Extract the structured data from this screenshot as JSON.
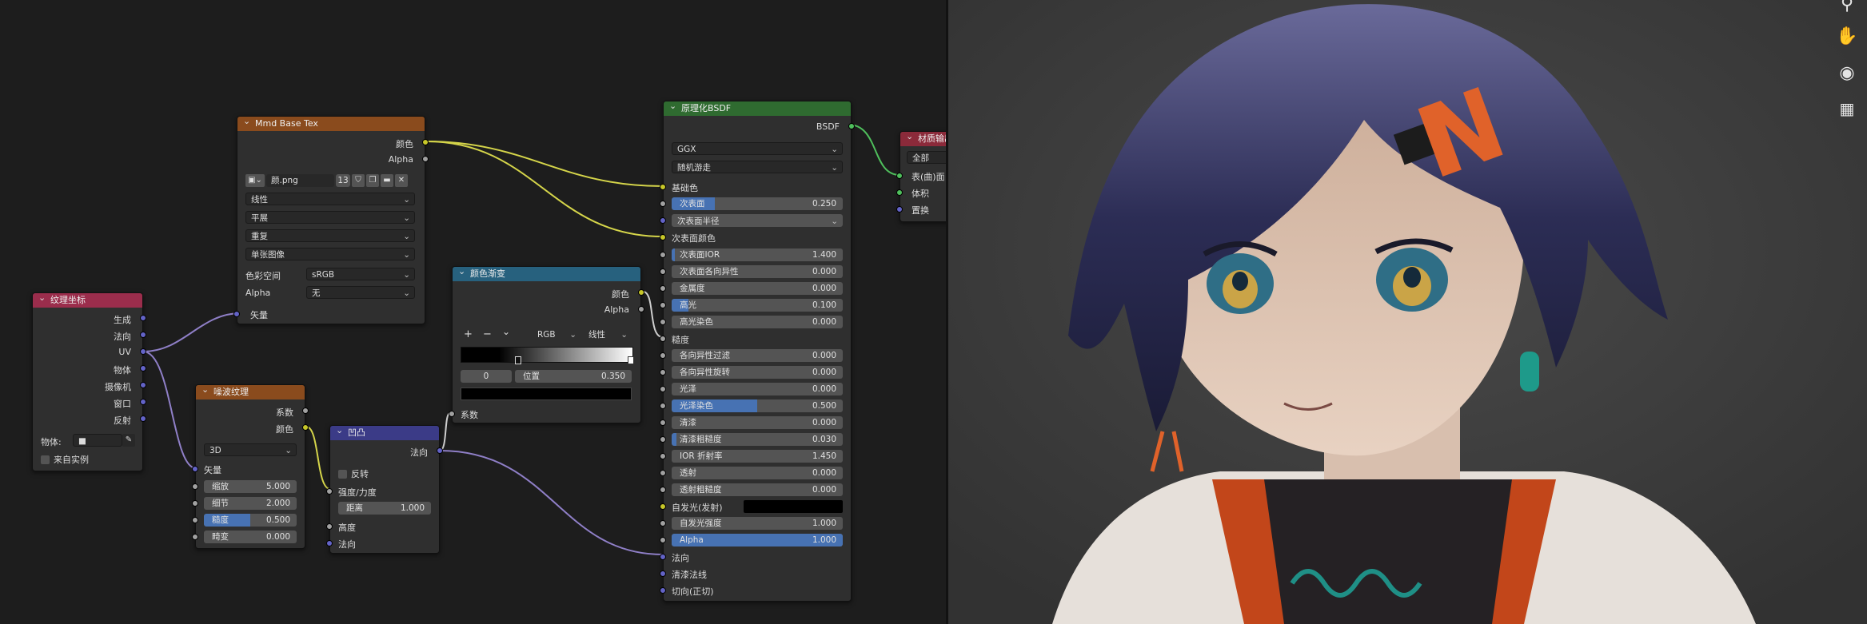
{
  "nodes": {
    "tex": {
      "title": "Mmd Base Tex",
      "out_color": "颜色",
      "out_alpha": "Alpha",
      "image_name": "颜.png",
      "users": "13",
      "interpolation": "线性",
      "projection": "平展",
      "extension": "重复",
      "source": "单张图像",
      "colorspace_label": "色彩空间",
      "colorspace": "sRGB",
      "alpha_label": "Alpha",
      "alpha_mode": "无",
      "in_vector": "矢量"
    },
    "coord": {
      "title": "纹理坐标",
      "outputs": [
        "生成",
        "法向",
        "UV",
        "物体",
        "摄像机",
        "窗口",
        "反射"
      ],
      "object_label": "物体:",
      "from_instancer": "来自实例"
    },
    "noise": {
      "title": "噪波纹理",
      "out_fac": "系数",
      "out_color": "颜色",
      "dimensions": "3D",
      "in_vector": "矢量",
      "fields": [
        {
          "label": "缩放",
          "value": "5.000"
        },
        {
          "label": "细节",
          "value": "2.000"
        },
        {
          "label": "糙度",
          "value": "0.500",
          "fill": 0.5
        },
        {
          "label": "畸变",
          "value": "0.000"
        }
      ]
    },
    "bump": {
      "title": "凹凸",
      "out_normal": "法向",
      "invert": "反转",
      "in_strength": "强度/力度",
      "distance_label": "距离",
      "distance_value": "1.000",
      "in_height": "高度",
      "in_normal": "法向"
    },
    "ramp": {
      "title": "颜色渐变",
      "out_color": "颜色",
      "out_alpha": "Alpha",
      "add": "+",
      "remove": "−",
      "menu": "⌄",
      "color_mode": "RGB",
      "interp": "线性",
      "stop_index": "0",
      "pos_label": "位置",
      "pos_value": "0.350",
      "in_fac": "系数"
    },
    "bsdf": {
      "title": "原理化BSDF",
      "out": "BSDF",
      "distribution": "GGX",
      "subsurface_method": "随机游走",
      "base_color": "基础色",
      "subsurface_label": "次表面",
      "subsurface_value": "0.250",
      "subsurface_radius": "次表面半径",
      "subsurface_color": "次表面颜色",
      "rows": [
        {
          "label": "次表面IOR",
          "value": "1.400",
          "fill": 0.02
        },
        {
          "label": "次表面各向异性",
          "value": "0.000",
          "fill": 0
        },
        {
          "label": "金属度",
          "value": "0.000",
          "fill": 0
        },
        {
          "label": "高光",
          "value": "0.100",
          "fill": 0.1
        },
        {
          "label": "高光染色",
          "value": "0.000",
          "fill": 0
        },
        {
          "label": "糙度",
          "plain": true
        },
        {
          "label": "各向异性过滤",
          "value": "0.000",
          "fill": 0
        },
        {
          "label": "各向异性旋转",
          "value": "0.000",
          "fill": 0
        },
        {
          "label": "光泽",
          "value": "0.000",
          "fill": 0
        },
        {
          "label": "光泽染色",
          "value": "0.500",
          "fill": 0.5
        },
        {
          "label": "清漆",
          "value": "0.000",
          "fill": 0
        },
        {
          "label": "清漆粗糙度",
          "value": "0.030",
          "fill": 0.03
        },
        {
          "label": "IOR 折射率",
          "value": "1.450",
          "fill": 0
        },
        {
          "label": "透射",
          "value": "0.000",
          "fill": 0
        },
        {
          "label": "透射粗糙度",
          "value": "0.000",
          "fill": 0
        }
      ],
      "emission": "自发光(发射)",
      "emission_strength_label": "自发光强度",
      "emission_strength_value": "1.000",
      "alpha_label": "Alpha",
      "alpha_value": "1.000",
      "in_normal": "法向",
      "in_clearcoat_normal": "清漆法线",
      "in_tangent": "切向(正切)"
    },
    "out": {
      "title": "材质输出",
      "target": "全部",
      "surface": "表(曲)面",
      "volume": "体积",
      "displacement": "置换"
    }
  },
  "viewport": {
    "icons": [
      "zoom-icon",
      "hand-icon",
      "camera-icon",
      "grid-icon"
    ]
  },
  "colors": {
    "tex_header": "#8a4b1d",
    "coord_header": "#9b2d4c",
    "bsdf_header": "#2f6b30",
    "ramp_header": "#27617e",
    "bump_header": "#3b3b87",
    "out_header": "#8b2a3a",
    "value_fill": "#4772b3"
  }
}
